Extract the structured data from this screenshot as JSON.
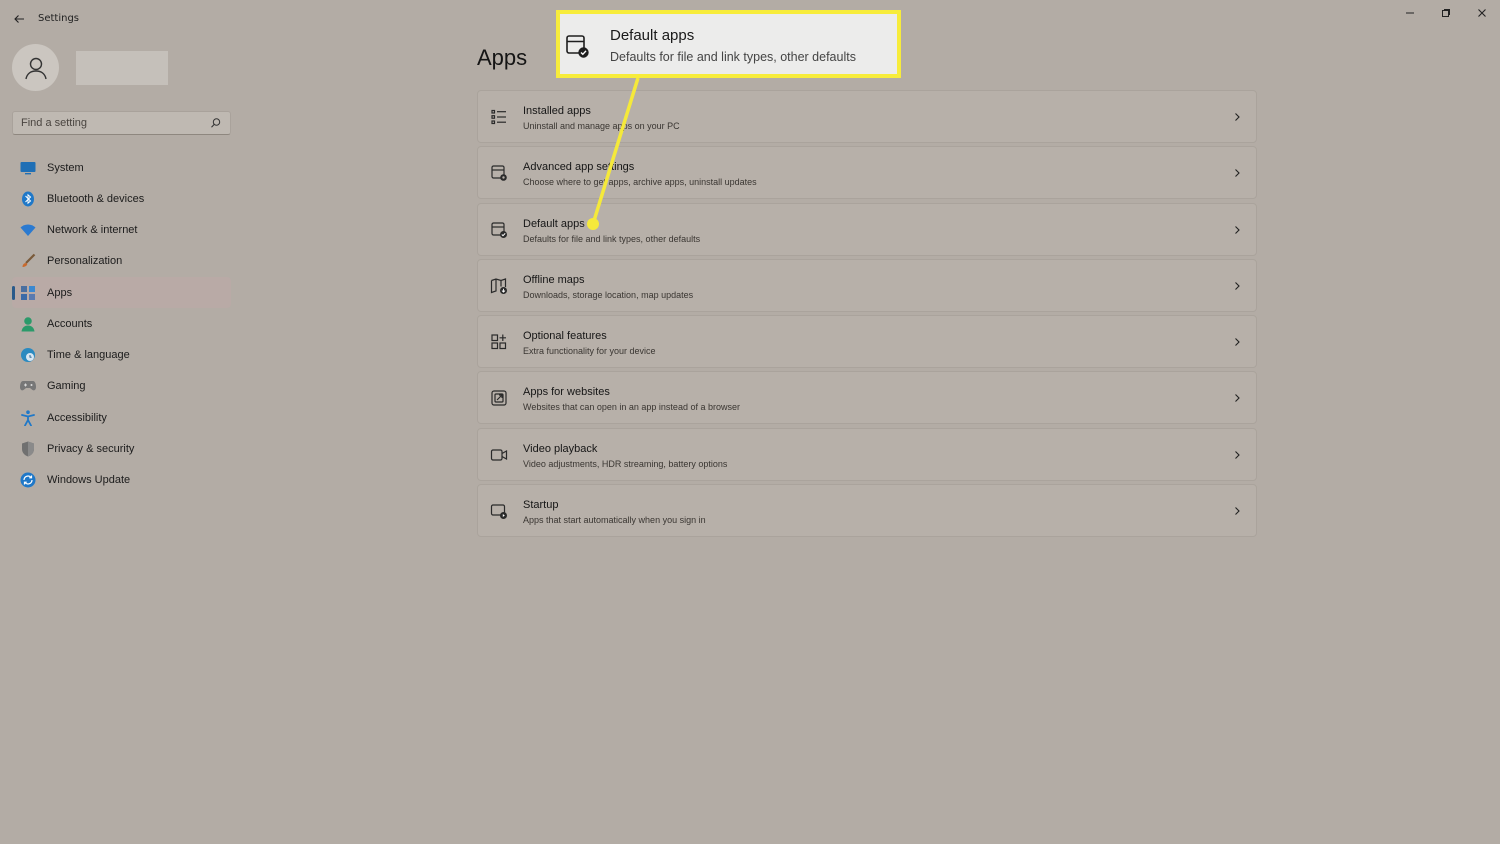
{
  "window": {
    "title": "Settings",
    "controls": [
      "minimize",
      "restore",
      "close"
    ]
  },
  "search": {
    "placeholder": "Find a setting"
  },
  "sidebar": {
    "items": [
      {
        "label": "System",
        "icon": "monitor-icon",
        "color": "#1f6fb5"
      },
      {
        "label": "Bluetooth & devices",
        "icon": "bluetooth-icon",
        "color": "#1f78c8"
      },
      {
        "label": "Network & internet",
        "icon": "wifi-icon",
        "color": "#2b7ad0"
      },
      {
        "label": "Personalization",
        "icon": "brush-icon",
        "color": "#c86a2e"
      },
      {
        "label": "Apps",
        "icon": "apps-icon",
        "color": "#3b6aa8",
        "active": true
      },
      {
        "label": "Accounts",
        "icon": "person-icon",
        "color": "#2b9a6a"
      },
      {
        "label": "Time & language",
        "icon": "globe-clock-icon",
        "color": "#2a8ac0"
      },
      {
        "label": "Gaming",
        "icon": "gamepad-icon",
        "color": "#777777"
      },
      {
        "label": "Accessibility",
        "icon": "accessibility-icon",
        "color": "#1f78c8"
      },
      {
        "label": "Privacy & security",
        "icon": "shield-icon",
        "color": "#707070"
      },
      {
        "label": "Windows Update",
        "icon": "update-icon",
        "color": "#1f78c8"
      }
    ]
  },
  "main": {
    "title": "Apps",
    "cards": [
      {
        "title": "Installed apps",
        "subtitle": "Uninstall and manage apps on your PC",
        "icon": "list-icon"
      },
      {
        "title": "Advanced app settings",
        "subtitle": "Choose where to get apps, archive apps, uninstall updates",
        "icon": "app-settings-icon"
      },
      {
        "title": "Default apps",
        "subtitle": "Defaults for file and link types, other defaults",
        "icon": "default-apps-icon"
      },
      {
        "title": "Offline maps",
        "subtitle": "Downloads, storage location, map updates",
        "icon": "map-icon"
      },
      {
        "title": "Optional features",
        "subtitle": "Extra functionality for your device",
        "icon": "grid-plus-icon"
      },
      {
        "title": "Apps for websites",
        "subtitle": "Websites that can open in an app instead of a browser",
        "icon": "open-link-icon"
      },
      {
        "title": "Video playback",
        "subtitle": "Video adjustments, HDR streaming, battery options",
        "icon": "video-icon"
      },
      {
        "title": "Startup",
        "subtitle": "Apps that start automatically when you sign in",
        "icon": "startup-icon"
      }
    ]
  },
  "callout": {
    "title": "Default apps",
    "subtitle": "Defaults for file and link types, other defaults",
    "border_color": "#f7ec3b"
  }
}
